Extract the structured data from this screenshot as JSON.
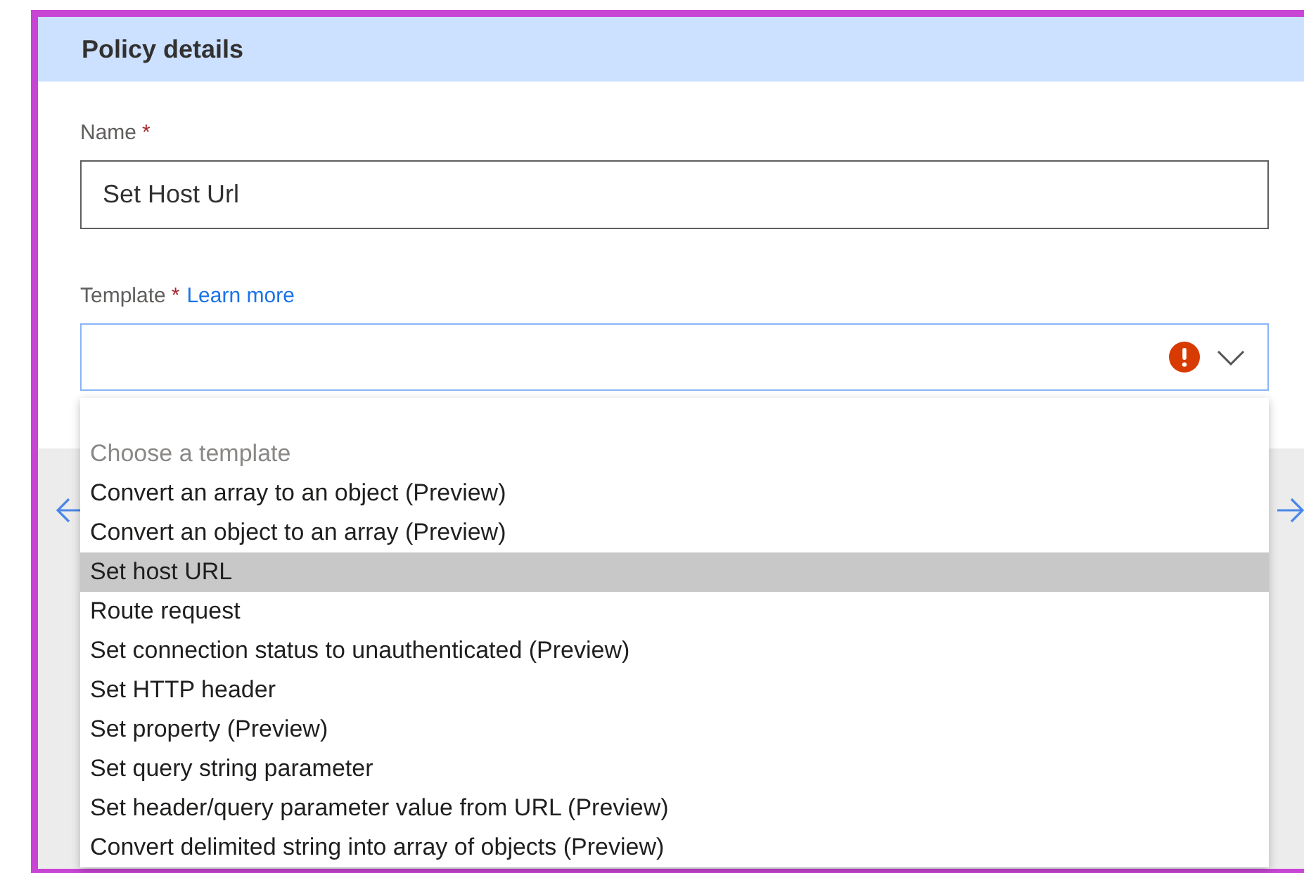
{
  "panel": {
    "title": "Policy details"
  },
  "name_field": {
    "label": "Name",
    "required_mark": "*",
    "value": "Set Host Url"
  },
  "template_field": {
    "label": "Template",
    "required_mark": "*",
    "link": "Learn more",
    "error": true,
    "expanded": true
  },
  "dropdown": {
    "heading": "Choose a template",
    "options": [
      {
        "label": "Convert an array to an object (Preview)",
        "selected": false
      },
      {
        "label": "Convert an object to an array (Preview)",
        "selected": false
      },
      {
        "label": "Set host URL",
        "selected": true
      },
      {
        "label": "Route request",
        "selected": false
      },
      {
        "label": "Set connection status to unauthenticated (Preview)",
        "selected": false
      },
      {
        "label": "Set HTTP header",
        "selected": false
      },
      {
        "label": "Set property (Preview)",
        "selected": false
      },
      {
        "label": "Set query string parameter",
        "selected": false
      },
      {
        "label": "Set header/query parameter value from URL (Preview)",
        "selected": false
      },
      {
        "label": "Convert delimited string into array of objects (Preview)",
        "selected": false
      }
    ]
  }
}
